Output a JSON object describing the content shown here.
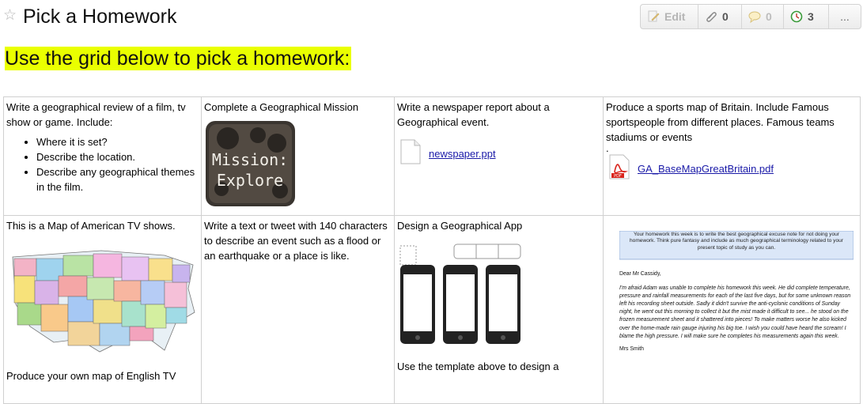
{
  "header": {
    "title": "Pick a Homework",
    "toolbar": {
      "edit_label": "Edit",
      "attachments_count": "0",
      "comments_count": "0",
      "history_count": "3",
      "more_label": "..."
    }
  },
  "banner": "Use the grid below to pick a homework:",
  "grid": {
    "r1c1": {
      "text": "Write a geographical review of a film, tv show or game. Include:",
      "bullets": [
        "Where it is set?",
        "Describe the location.",
        "Describe any geographical themes in the film."
      ]
    },
    "r1c2": {
      "text": "Complete a Geographical Mission",
      "image_line1": "Mission:",
      "image_line2": "Explore"
    },
    "r1c3": {
      "text": "Write a newspaper report about a Geographical event.",
      "file": "newspaper.ppt"
    },
    "r1c4": {
      "text": "Produce a sports map of Britain. Include Famous sportspeople from different places. Famous teams stadiums or events",
      "dot": ".",
      "file": "GA_BaseMapGreatBritain.pdf"
    },
    "r2c1": {
      "text": "This is a Map of American TV shows.",
      "bottom_text": "Produce your own map of English TV"
    },
    "r2c2": {
      "text": "Write a text or tweet with 140 characters to describe an event such as a flood or an earthquake or a place is like."
    },
    "r2c3": {
      "text": "Design a Geographical App",
      "bottom_text": "Use the template above to design a"
    },
    "r2c4": {
      "note": "Your homework this week is to write the best geographical excuse note for not doing your homework. Think pure fantasy and include as much geographical terminology related to your present topic of study as you can.",
      "salutation": "Dear Mr Cassidy,",
      "body": "I'm afraid Adam was unable to complete his homework this week. He did complete temperature, pressure and rainfall measurements for each of the last five days, but for some unknown reason left his recording sheet outside. Sadly it didn't survive the anti-cyclonic conditions of Sunday night, he went out this morning to collect it but the mist made it difficult to see... he stood on the frozen measurement sheet and it shattered into pieces! To make matters worse he also kicked over the home-made rain gauge injuring his big toe. I wish you could have heard the scream! I blame the high pressure. I will make sure he completes his measurements again this week.",
      "signature": "Mrs Smith"
    }
  },
  "colors": {
    "banner_highlight": "#eaff00",
    "link": "#1a1aa8",
    "pdf_red": "#d9251d",
    "note_blue": "#dbe7f8"
  }
}
